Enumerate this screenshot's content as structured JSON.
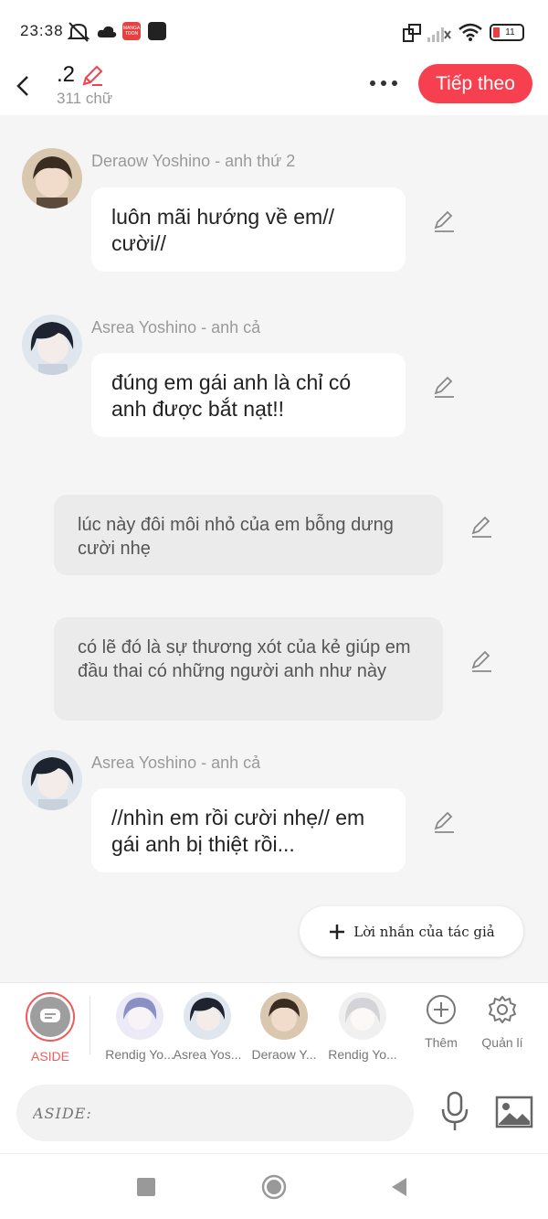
{
  "status_bar": {
    "time": "23:38",
    "battery_level": "11",
    "icons": [
      "mute-icon",
      "cloud-icon",
      "mangatoon-icon",
      "app-icon",
      "screen-rotate-icon",
      "signal-icon",
      "wifi-icon",
      "battery-icon"
    ],
    "mangatoon_label": "MANGA TOON"
  },
  "header": {
    "chapter_title": ".2",
    "word_count": "311 chữ",
    "next_button": "Tiếp theo"
  },
  "messages": [
    {
      "type": "character",
      "sender": "Deraow Yoshino - anh thứ 2",
      "text": "luôn mãi hướng về em// cười//"
    },
    {
      "type": "character",
      "sender": "Asrea Yoshino - anh cả",
      "text": "đúng em gái anh là chỉ có anh được bắt nạt!!"
    },
    {
      "type": "narration",
      "text": "lúc này đôi môi nhỏ của em bỗng dưng cười nhẹ"
    },
    {
      "type": "narration",
      "text": "có lẽ đó là sự thương xót của kẻ giúp em đầu thai có những người anh như này"
    },
    {
      "type": "character",
      "sender": "Asrea Yoshino - anh cả",
      "text": "//nhìn em rồi cười nhẹ// em gái anh bị thiệt rồi..."
    }
  ],
  "author_note_button": "Lời nhắn của tác giả",
  "characters": [
    {
      "label": "ASIDE",
      "selected": true
    },
    {
      "label": "Rendig Yo..."
    },
    {
      "label": "Asrea Yos..."
    },
    {
      "label": "Deraow Y..."
    },
    {
      "label": "Rendig Yo..."
    }
  ],
  "tools": {
    "add_label": "Thêm",
    "manage_label": "Quản lí"
  },
  "input": {
    "placeholder": "ASIDE:"
  },
  "colors": {
    "accent": "#f6404f",
    "bubble": "#ffffff",
    "narration": "#ebebeb",
    "background": "#f5f5f5"
  }
}
